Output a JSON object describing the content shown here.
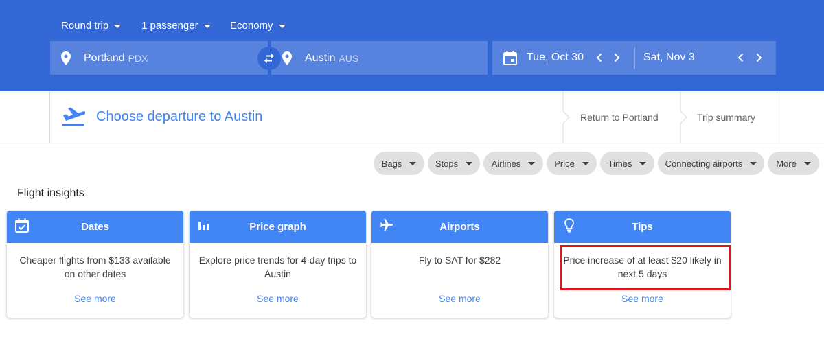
{
  "search": {
    "trip_type": "Round trip",
    "passengers": "1 passenger",
    "cabin": "Economy",
    "origin_city": "Portland",
    "origin_code": "PDX",
    "dest_city": "Austin",
    "dest_code": "AUS",
    "depart_date": "Tue, Oct 30",
    "return_date": "Sat, Nov 3"
  },
  "steps": {
    "current": "Choose departure to Austin",
    "return": "Return to Portland",
    "summary": "Trip summary"
  },
  "filters": [
    "Bags",
    "Stops",
    "Airlines",
    "Price",
    "Times",
    "Connecting airports",
    "More"
  ],
  "insights": {
    "title": "Flight insights",
    "cards": [
      {
        "title": "Dates",
        "body": "Cheaper flights from $133 available on other dates",
        "link": "See more",
        "icon": "calendar-check-icon"
      },
      {
        "title": "Price graph",
        "body": "Explore price trends for 4-day trips to Austin",
        "link": "See more",
        "icon": "bar-chart-icon"
      },
      {
        "title": "Airports",
        "body": "Fly to SAT for $282",
        "link": "See more",
        "icon": "airplane-icon"
      },
      {
        "title": "Tips",
        "body": "Price increase of at least $20 likely in next 5 days",
        "link": "See more",
        "icon": "lightbulb-icon"
      }
    ]
  },
  "colors": {
    "header_bg": "#3367d6",
    "accent": "#4285f4",
    "chip_bg": "#e0e0e0",
    "highlight": "#e0161e"
  }
}
